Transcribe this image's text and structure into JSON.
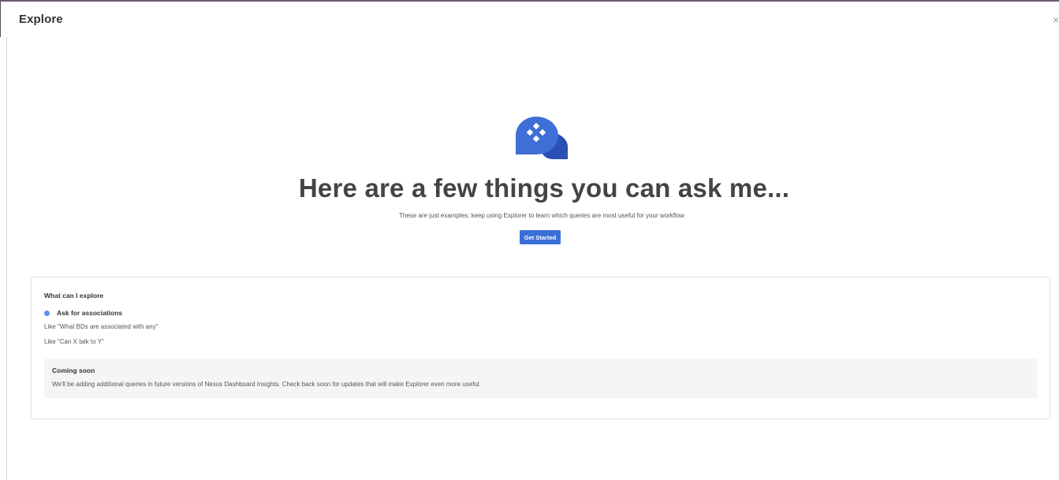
{
  "header": {
    "title": "Explore",
    "close_glyph": "×"
  },
  "hero": {
    "icon": "chat-diamond-icon",
    "title": "Here are a few things you can ask me...",
    "subtitle": "These are just examples; keep using Explorer to learn which queries are most useful for your workflow",
    "button_label": "Get Started"
  },
  "card": {
    "title": "What can I explore",
    "section_label": "Ask for associations",
    "examples": [
      "Like \"What BDs are associated with any\"",
      "Like \"Can X talk to Y\""
    ],
    "coming_soon": {
      "title": "Coming soon",
      "text": "We'll be adding additional queries in future versions of Nexus Dashboard Insights. Check back soon for updates that will make Explorer even more useful."
    }
  },
  "colors": {
    "accent": "#3b6fd8",
    "icon_primary": "#3f6fd6",
    "icon_dark": "#2a4fb5",
    "bullet": "#5b8ff0"
  }
}
